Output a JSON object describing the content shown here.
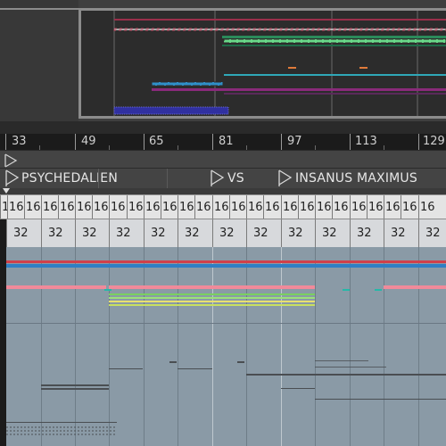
{
  "ruler": {
    "bar_numbers": [
      "33",
      "49",
      "65",
      "81",
      "97",
      "113",
      "129"
    ]
  },
  "locators": {
    "first": "PSYCHEDALIEN",
    "second": "VS",
    "third": "INSANUS MAXIMUS"
  },
  "clip_lengths": {
    "row_a": [
      "16",
      "16",
      "16",
      "16",
      "16",
      "16",
      "16",
      "16",
      "16",
      "16",
      "16",
      "16",
      "16",
      "16",
      "16",
      "16",
      "16",
      "16",
      "16",
      "16",
      "16",
      "16",
      "16",
      "16",
      "16",
      "16"
    ],
    "row_b": [
      "32",
      "32",
      "32",
      "32",
      "32",
      "32",
      "32",
      "32",
      "32",
      "32",
      "32",
      "32",
      "32"
    ]
  },
  "colors": {
    "overview_background": "#3f3f3f",
    "arrangement_background": "#8a9aa6",
    "clip_red": "#d0404a",
    "clip_blue": "#2f7fc4",
    "clip_pink": "#f08a9a",
    "clip_teal": "#25b8a8",
    "clip_green": "#9be07a",
    "clip_yellow": "#e8e070",
    "clip_dark": "#4a4e52"
  },
  "icons": {
    "locator_marker": "locator-flag-icon"
  }
}
